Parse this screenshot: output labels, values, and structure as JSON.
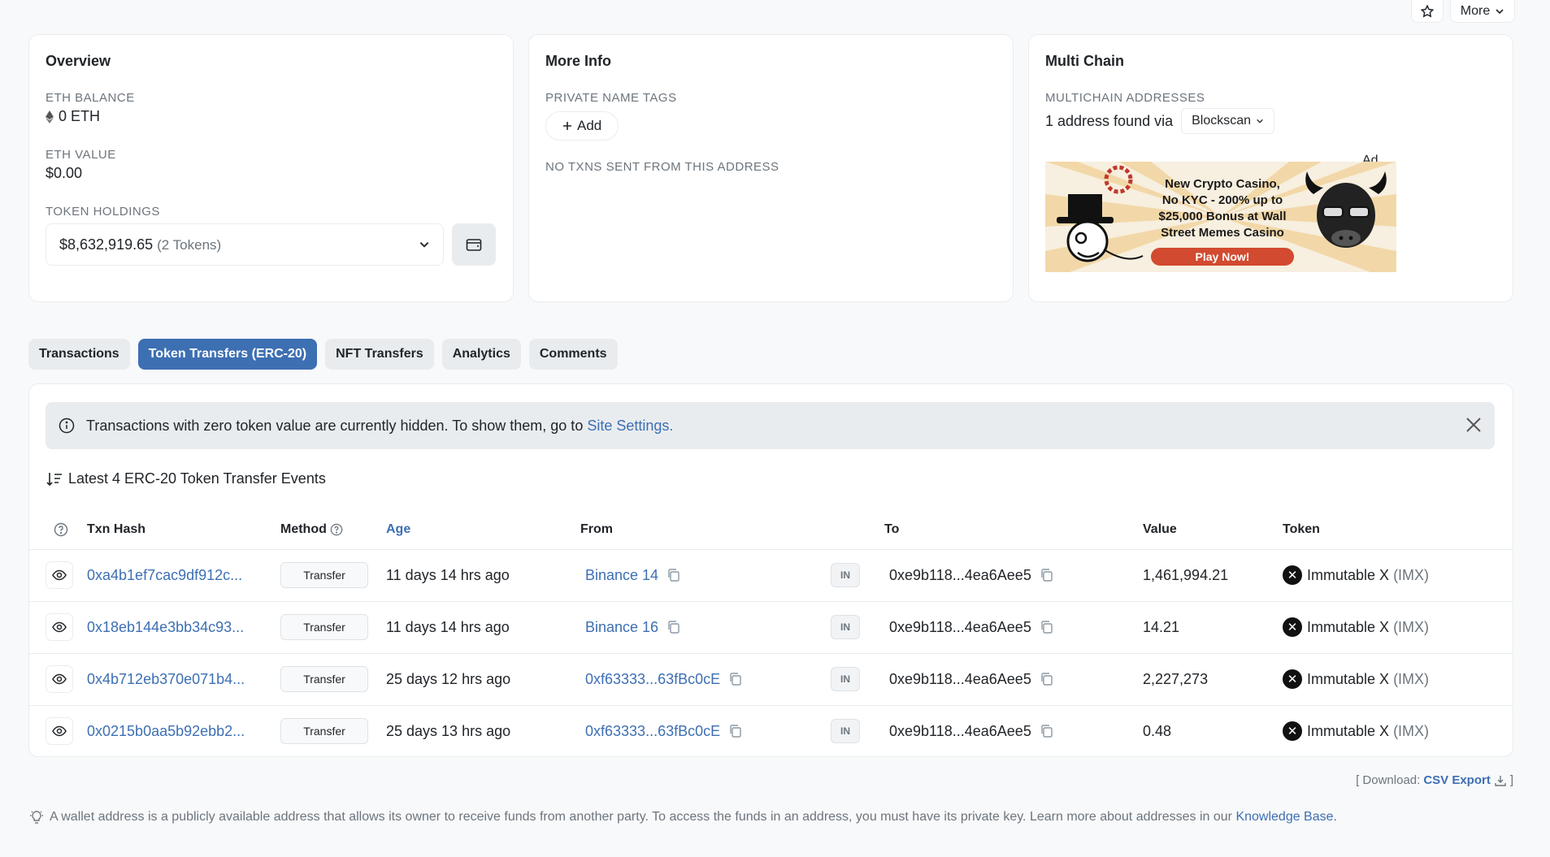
{
  "top_actions": {
    "more_label": "More"
  },
  "overview": {
    "title": "Overview",
    "eth_balance_label": "ETH BALANCE",
    "eth_balance_value": "0 ETH",
    "eth_value_label": "ETH VALUE",
    "eth_value_value": "$0.00",
    "token_holdings_label": "TOKEN HOLDINGS",
    "token_holdings_value": "$8,632,919.65",
    "token_holdings_count": "(2 Tokens)"
  },
  "more_info": {
    "title": "More Info",
    "private_name_tags_label": "PRIVATE NAME TAGS",
    "add_label": "Add",
    "no_txns_label": "NO TXNS SENT FROM THIS ADDRESS"
  },
  "multi_chain": {
    "title": "Multi Chain",
    "addresses_label": "MULTICHAIN ADDRESSES",
    "found_text": "1 address found via",
    "provider": "Blockscan",
    "ad_label": "Ad",
    "ad": {
      "line1": "New Crypto Casino,",
      "line2": "No KYC - 200% up to",
      "line3": "$25,000 Bonus at Wall",
      "line4": "Street Memes Casino",
      "cta": "Play Now!"
    }
  },
  "tabs": [
    {
      "label": "Transactions",
      "active": false
    },
    {
      "label": "Token Transfers (ERC-20)",
      "active": true
    },
    {
      "label": "NFT Transfers",
      "active": false
    },
    {
      "label": "Analytics",
      "active": false
    },
    {
      "label": "Comments",
      "active": false
    }
  ],
  "alert": {
    "text": "Transactions with zero token value are currently hidden. To show them, go to",
    "link": "Site Settings."
  },
  "events_title": "Latest 4 ERC-20 Token Transfer Events",
  "table": {
    "headers": {
      "txn_hash": "Txn Hash",
      "method": "Method",
      "age": "Age",
      "from": "From",
      "to": "To",
      "value": "Value",
      "token": "Token"
    },
    "rows": [
      {
        "hash": "0xa4b1ef7cac9df912c...",
        "method": "Transfer",
        "age": "11 days 14 hrs ago",
        "from": "Binance 14",
        "direction": "IN",
        "to": "0xe9b118...4ea6Aee5",
        "value": "1,461,994.21",
        "token_name": "Immutable X",
        "token_symbol": "(IMX)"
      },
      {
        "hash": "0x18eb144e3bb34c93...",
        "method": "Transfer",
        "age": "11 days 14 hrs ago",
        "from": "Binance 16",
        "direction": "IN",
        "to": "0xe9b118...4ea6Aee5",
        "value": "14.21",
        "token_name": "Immutable X",
        "token_symbol": "(IMX)"
      },
      {
        "hash": "0x4b712eb370e071b4...",
        "method": "Transfer",
        "age": "25 days 12 hrs ago",
        "from": "0xf63333...63fBc0cE",
        "direction": "IN",
        "to": "0xe9b118...4ea6Aee5",
        "value": "2,227,273",
        "token_name": "Immutable X",
        "token_symbol": "(IMX)"
      },
      {
        "hash": "0x0215b0aa5b92ebb2...",
        "method": "Transfer",
        "age": "25 days 13 hrs ago",
        "from": "0xf63333...63fBc0cE",
        "direction": "IN",
        "to": "0xe9b118...4ea6Aee5",
        "value": "0.48",
        "token_name": "Immutable X",
        "token_symbol": "(IMX)"
      }
    ]
  },
  "download": {
    "prefix": "[ Download:",
    "link": "CSV Export",
    "suffix": "]"
  },
  "footer": {
    "text": "A wallet address is a publicly available address that allows its owner to receive funds from another party. To access the funds in an address, you must have its private key. Learn more about addresses in our",
    "link": "Knowledge Base."
  },
  "colors": {
    "accent": "#3d6fb3",
    "background": "#f8f9fa",
    "muted": "#6c757d"
  }
}
